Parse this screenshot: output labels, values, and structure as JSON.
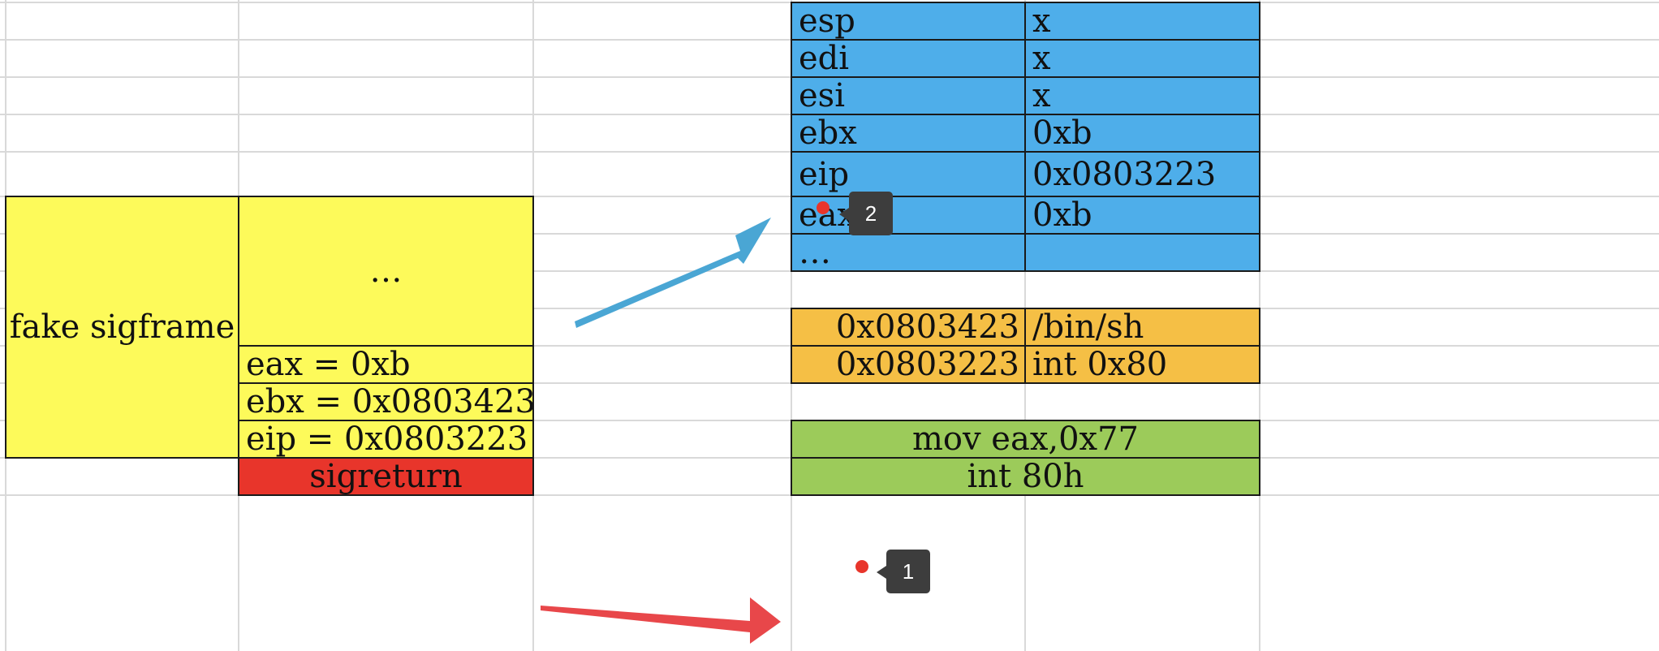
{
  "sigframe": {
    "label": "fake sigframe",
    "ellipsis": "…",
    "eax": "eax = 0xb",
    "ebx": "ebx = 0x0803423",
    "eip": "eip = 0x0803223",
    "sigreturn": "sigreturn"
  },
  "registers": [
    {
      "name": "esp",
      "value": "x"
    },
    {
      "name": "edi",
      "value": "x"
    },
    {
      "name": "esi",
      "value": "x"
    },
    {
      "name": "ebx",
      "value": "0xb"
    },
    {
      "name": "eip",
      "value": "0x0803223"
    },
    {
      "name": "eax",
      "value": "0xb"
    },
    {
      "name": "…",
      "value": ""
    }
  ],
  "memory": [
    {
      "address": "0x0803423",
      "content": "/bin/sh"
    },
    {
      "address": "0x0803223",
      "content": "int 0x80"
    }
  ],
  "code": [
    "mov eax,0x77",
    "int 80h"
  ],
  "badges": {
    "first": "1",
    "second": "2"
  },
  "colors": {
    "yellow": "#fdfa5a",
    "red": "#e8352b",
    "blue": "#4eaeea",
    "orange": "#f5bf45",
    "green": "#9ccb5a",
    "arrow_red": "#e8474a",
    "arrow_blue": "#4aa6d4"
  }
}
